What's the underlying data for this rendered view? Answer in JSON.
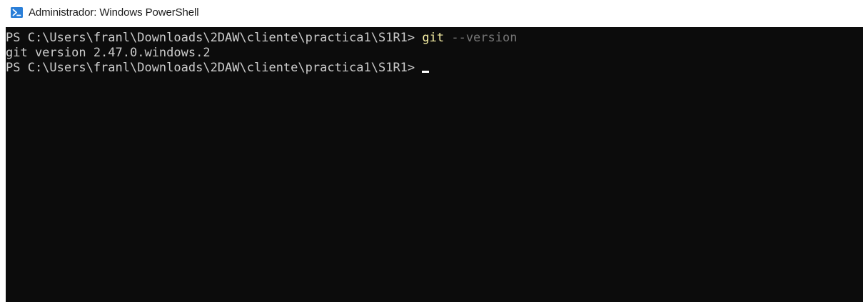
{
  "window": {
    "title": "Administrador: Windows PowerShell",
    "icon": "powershell-icon"
  },
  "console": {
    "line1": {
      "prompt": "PS C:\\Users\\franl\\Downloads\\2DAW\\cliente\\practica1\\S1R1> ",
      "command": "git",
      "argument": " --version"
    },
    "line2": {
      "output": "git version 2.47.0.windows.2"
    },
    "line3": {
      "prompt": "PS C:\\Users\\franl\\Downloads\\2DAW\\cliente\\practica1\\S1R1> "
    }
  },
  "colors": {
    "terminal_background": "#0c0c0c",
    "text": "#cccccc",
    "command_highlight": "#f9f1a5",
    "argument": "#767676",
    "icon_accent": "#2b7fd8"
  }
}
